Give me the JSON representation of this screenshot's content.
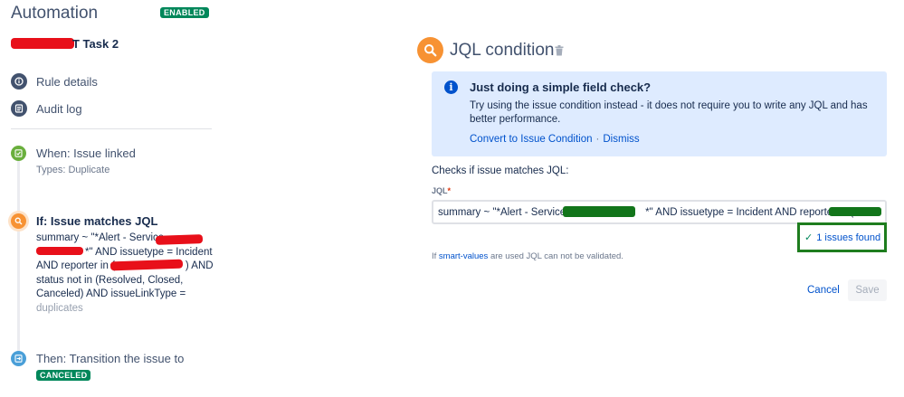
{
  "app": {
    "title": "Automation",
    "status_badge": "ENABLED"
  },
  "rule": {
    "name_visible": "T Task 2"
  },
  "nav": [
    {
      "label": "Rule details",
      "icon": "info-icon"
    },
    {
      "label": "Audit log",
      "icon": "audit-log-icon"
    }
  ],
  "steps": {
    "trigger": {
      "title": "When: Issue linked",
      "subtitle": "Types: Duplicate",
      "icon": "trigger-icon",
      "color": "#6aaf3d"
    },
    "condition": {
      "title": "If: Issue matches JQL",
      "icon": "search-icon",
      "color": "#f79233",
      "lines": [
        "summary ~ \"*Alert - Service",
        "*\" AND issuetype = Incident",
        "AND reporter in (",
        ") AND",
        "status not in (Resolved, Closed,",
        "Canceled) AND issueLinkType =",
        "duplicates"
      ]
    },
    "action": {
      "title": "Then: Transition the issue to",
      "badge": "CANCELED",
      "icon": "transition-icon",
      "color": "#4a9fd8"
    }
  },
  "editor": {
    "title": "JQL condition",
    "info": {
      "title": "Just doing a simple field check?",
      "text": "Try using the issue condition instead - it does not require you to write any JQL and has better performance.",
      "convert_link": "Convert to Issue Condition",
      "separator": "·",
      "dismiss_link": "Dismiss"
    },
    "checks_label": "Checks if issue matches JQL:",
    "jql_label": "JQL",
    "required_marker": "*",
    "jql_prefix": "summary ~ \"*Alert - Service",
    "jql_suffix": "*\" AND issuetype = Incident AND reporter in (",
    "issues_found_check": "✓",
    "issues_found": "1 issues found",
    "hint_prefix": "If",
    "hint_link": "smart-values",
    "hint_suffix": "are used JQL can not be validated.",
    "cancel_label": "Cancel",
    "save_label": "Save"
  },
  "colors": {
    "accent": "#0052cc",
    "success": "#00875a",
    "info_bg": "#deebff"
  }
}
